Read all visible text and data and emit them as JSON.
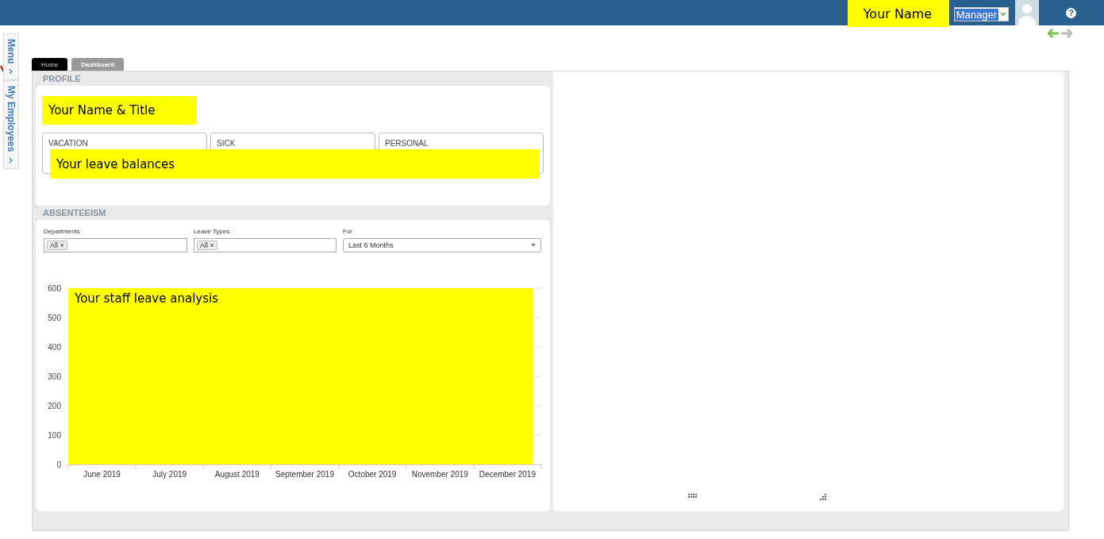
{
  "topbar": {
    "user_name": "Your Name",
    "role": "Manager",
    "help": "?"
  },
  "side_tabs": [
    {
      "label": "Menu"
    },
    {
      "label": "My Employees"
    }
  ],
  "tabs": [
    {
      "label": "Home",
      "selected": true
    },
    {
      "label": "Dashboard",
      "selected": false
    }
  ],
  "profile": {
    "title": "PROFILE",
    "name_note": "Your Name & Title",
    "balances": [
      {
        "label": "VACATION"
      },
      {
        "label": "SICK"
      },
      {
        "label": "PERSONAL"
      }
    ],
    "balances_note": "Your leave balances"
  },
  "absenteeism": {
    "title": "ABSENTEEISM",
    "filters": [
      {
        "kind": "tags",
        "label": "Departments",
        "tags": [
          {
            "label": "All",
            "remove": "×"
          }
        ]
      },
      {
        "kind": "tags",
        "label": "Leave Types",
        "tags": [
          {
            "label": "All",
            "remove": "×"
          }
        ]
      },
      {
        "kind": "select",
        "label": "For",
        "value": "Last 6 Months"
      }
    ],
    "chart_note": "Your staff leave analysis",
    "chart_data": {
      "type": "bar",
      "categories": [
        "June 2019",
        "July 2019",
        "August 2019",
        "September 2019",
        "October 2019",
        "November 2019",
        "December 2019"
      ],
      "values": [
        null,
        null,
        null,
        null,
        null,
        null,
        null
      ],
      "ylim": [
        0,
        600
      ],
      "yticks": [
        0,
        100,
        200,
        300,
        400,
        500,
        600
      ]
    }
  }
}
